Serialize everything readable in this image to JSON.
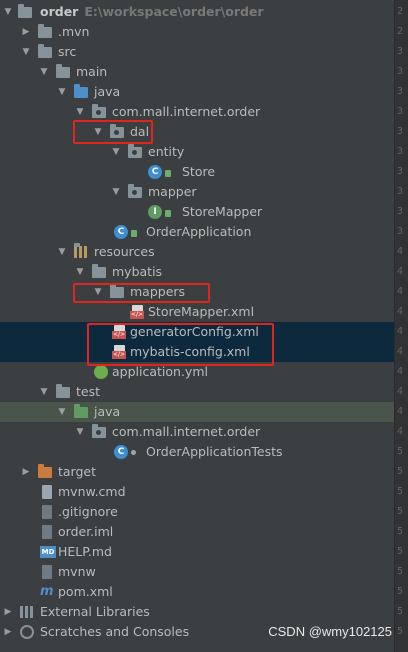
{
  "project": {
    "name": "order",
    "path": "E:\\workspace\\order\\order"
  },
  "tree": {
    "mvn": ".mvn",
    "src": "src",
    "main": "main",
    "java": "java",
    "pkg_main": "com.mall.internet.order",
    "dal": "dal",
    "entity": "entity",
    "store": "Store",
    "mapper": "mapper",
    "store_mapper": "StoreMapper",
    "order_application": "OrderApplication",
    "resources": "resources",
    "mybatis": "mybatis",
    "mappers": "mappers",
    "store_mapper_xml": "StoreMapper.xml",
    "generator_config": "generatorConfig.xml",
    "mybatis_config": "mybatis-config.xml",
    "application_yml": "application.yml",
    "test": "test",
    "java_test": "java",
    "pkg_test": "com.mall.internet.order",
    "order_application_tests": "OrderApplicationTests",
    "target": "target",
    "mvnw_cmd": "mvnw.cmd",
    "gitignore": ".gitignore",
    "order_iml": "order.iml",
    "help_md": "HELP.md",
    "mvnw": "mvnw",
    "pom": "pom.xml",
    "external_libraries": "External Libraries",
    "scratches": "Scratches and Consoles"
  },
  "watermark": "CSDN @wmy102125",
  "gutter_numbers": [
    "2",
    "2",
    "3",
    "3",
    "3",
    "3",
    "3",
    "3",
    "3",
    "3",
    "3",
    "3",
    "4",
    "4",
    "4",
    "4",
    "4",
    "4",
    "4",
    "4",
    "4",
    "4",
    "5",
    "5",
    "5",
    "5",
    "5",
    "5",
    "5",
    "5",
    "5",
    "5"
  ],
  "colors": {
    "background": "#3c3f41",
    "selection": "#0d293e",
    "test_folder_bg": "#49544a",
    "highlight": "#e0251c"
  }
}
